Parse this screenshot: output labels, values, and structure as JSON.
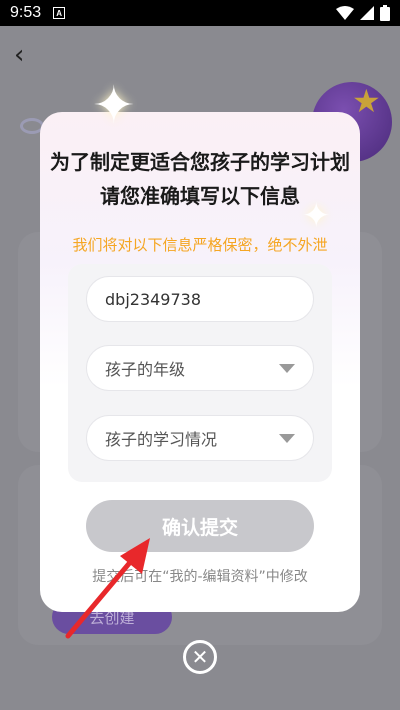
{
  "status_bar": {
    "time": "9:53",
    "app_badge": "A",
    "wifi_icon": "wifi-icon",
    "signal_icon": "signal-icon",
    "battery_icon": "battery-icon"
  },
  "background": {
    "back_icon": "back-arrow-icon",
    "create_button_label": "去创建"
  },
  "modal": {
    "title_line_1": "为了制定更适合您孩子的学习计划",
    "title_line_2": "请您准确填写以下信息",
    "privacy_notice": "我们将对以下信息严格保密，绝不外泄",
    "name_field_value": "dbj2349738",
    "grade_placeholder": "孩子的年级",
    "status_placeholder": "孩子的学习情况",
    "submit_label": "确认提交",
    "footer_note": "提交后可在“我的-编辑资料”中修改"
  },
  "close_icon": "close-circle-icon",
  "colors": {
    "notice": "#f5a623",
    "submit_disabled": "#c8c8cc",
    "pointer_arrow": "#e8282b"
  }
}
